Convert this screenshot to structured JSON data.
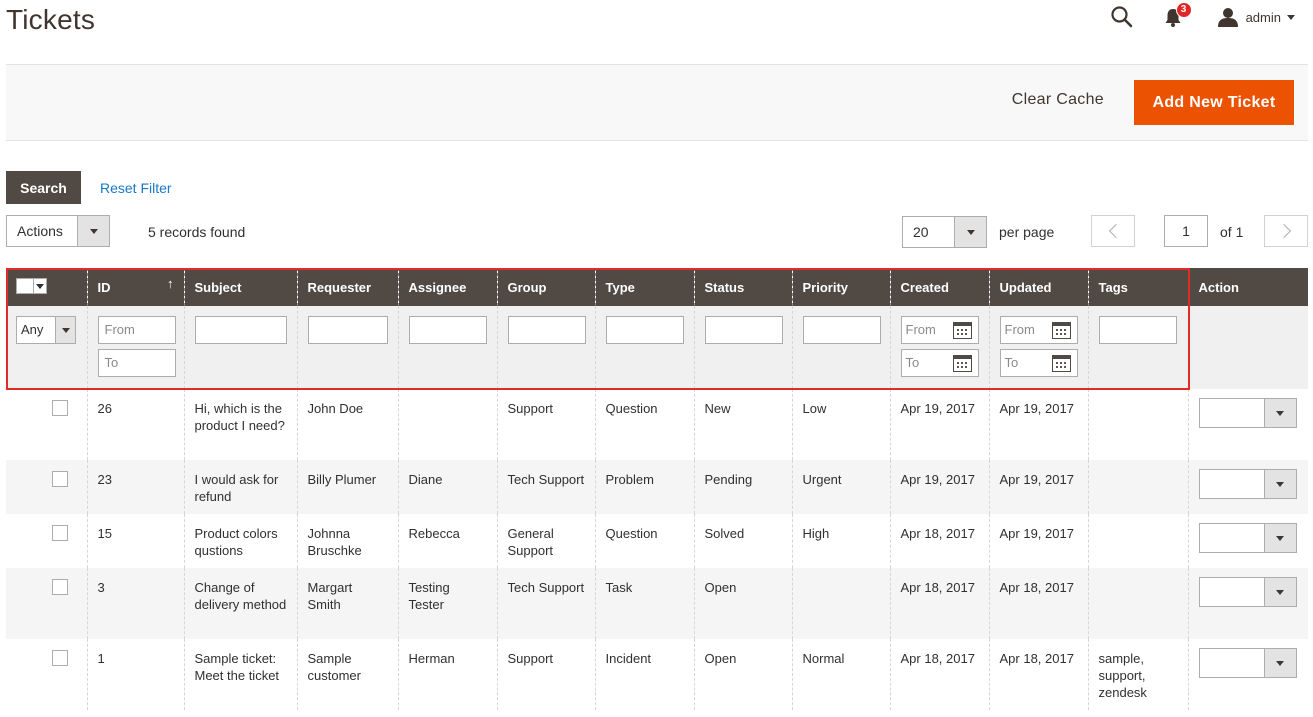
{
  "page": {
    "title": "Tickets"
  },
  "header": {
    "notifications_count": "3",
    "user_name": "admin"
  },
  "toolbar": {
    "clear_cache_label": "Clear Cache",
    "add_ticket_label": "Add New Ticket"
  },
  "filters_bar": {
    "search_label": "Search",
    "reset_label": "Reset Filter",
    "actions_label": "Actions",
    "records_found": "5 records found",
    "per_page_value": "20",
    "per_page_label": "per page",
    "page_value": "1",
    "page_of": "of 1"
  },
  "grid": {
    "columns": {
      "id": "ID",
      "sort_indicator": "↑",
      "subject": "Subject",
      "requester": "Requester",
      "assignee": "Assignee",
      "group": "Group",
      "type": "Type",
      "status": "Status",
      "priority": "Priority",
      "created": "Created",
      "updated": "Updated",
      "tags": "Tags",
      "action": "Action"
    },
    "filters": {
      "mass_any": "Any",
      "from": "From",
      "to": "To"
    },
    "rows": [
      {
        "id": "26",
        "subject": "Hi, which is the product I need?",
        "requester": "John Doe",
        "assignee": "",
        "group": "Support",
        "type": "Question",
        "status": "New",
        "priority": "Low",
        "created": "Apr 19, 2017",
        "updated": "Apr 19, 2017",
        "tags": ""
      },
      {
        "id": "23",
        "subject": "I would ask for refund",
        "requester": "Billy Plumer",
        "assignee": "Diane",
        "group": "Tech Support",
        "type": "Problem",
        "status": "Pending",
        "priority": "Urgent",
        "created": "Apr 19, 2017",
        "updated": "Apr 19, 2017",
        "tags": ""
      },
      {
        "id": "15",
        "subject": "Product colors qustions",
        "requester": "Johnna Bruschke",
        "assignee": "Rebecca",
        "group": "General Support",
        "type": "Question",
        "status": "Solved",
        "priority": "High",
        "created": "Apr 18, 2017",
        "updated": "Apr 19, 2017",
        "tags": ""
      },
      {
        "id": "3",
        "subject": "Change of delivery method",
        "requester": "Margart Smith",
        "assignee": "Testing Tester",
        "group": "Tech Support",
        "type": "Task",
        "status": "Open",
        "priority": "",
        "created": "Apr 18, 2017",
        "updated": "Apr 18, 2017",
        "tags": ""
      },
      {
        "id": "1",
        "subject": "Sample ticket: Meet the ticket",
        "requester": "Sample customer",
        "assignee": "Herman",
        "group": "Support",
        "type": "Incident",
        "status": "Open",
        "priority": "Normal",
        "created": "Apr 18, 2017",
        "updated": "Apr 18, 2017",
        "tags": "sample, support, zendesk"
      }
    ]
  },
  "colors": {
    "accent": "#eb5202",
    "header_bg": "#514943",
    "link": "#1979c3",
    "highlight": "#e02b27"
  },
  "icons": [
    "search-icon",
    "bell-icon",
    "user-icon",
    "calendar-icon",
    "chevron-left-icon",
    "chevron-right-icon",
    "chevron-down-icon"
  ]
}
